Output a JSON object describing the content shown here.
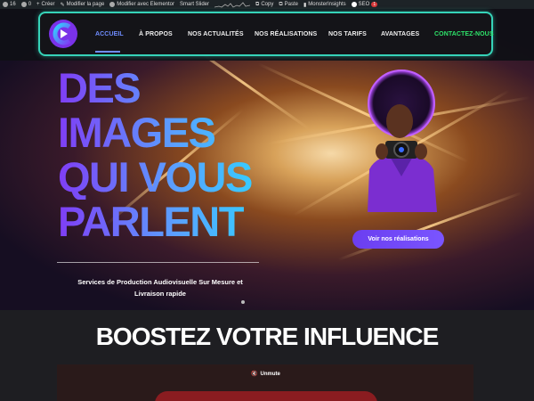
{
  "adminbar": {
    "count": "16",
    "comments": "0",
    "new": "Créer",
    "edit_page": "Modifier la page",
    "elementor": "Modifier avec Elementor",
    "slider": "Smart Slider",
    "copy": "Copy",
    "paste": "Paste",
    "monsterinsights": "MonsterInsights",
    "seo": "SEO",
    "seo_badge": "1"
  },
  "nav": {
    "items": [
      {
        "label": "ACCUEIL",
        "active": true
      },
      {
        "label": "À PROPOS"
      },
      {
        "label": "NOS ACTUALITÉS"
      },
      {
        "label": "NOS RÉALISATIONS"
      },
      {
        "label": "NOS TARIFS"
      },
      {
        "label": "AVANTAGES"
      },
      {
        "label": "CONTACTEZ-NOUS"
      }
    ]
  },
  "hero": {
    "lines": [
      "DES",
      "IMAGES",
      "QUI VOUS",
      "PARLENT"
    ],
    "subtitle": "Services de Production Audiovisuelle Sur Mesure et Livraison rapide",
    "cta": "Voir nos réalisations"
  },
  "section": {
    "title": "BOOSTEZ VOTRE INFLUENCE",
    "unmute": "Unmute"
  },
  "colors": {
    "accent": "#36d3b8",
    "nav_active": "#6f8dff",
    "contact": "#2ee46a",
    "cta": "#6b3ef0"
  }
}
